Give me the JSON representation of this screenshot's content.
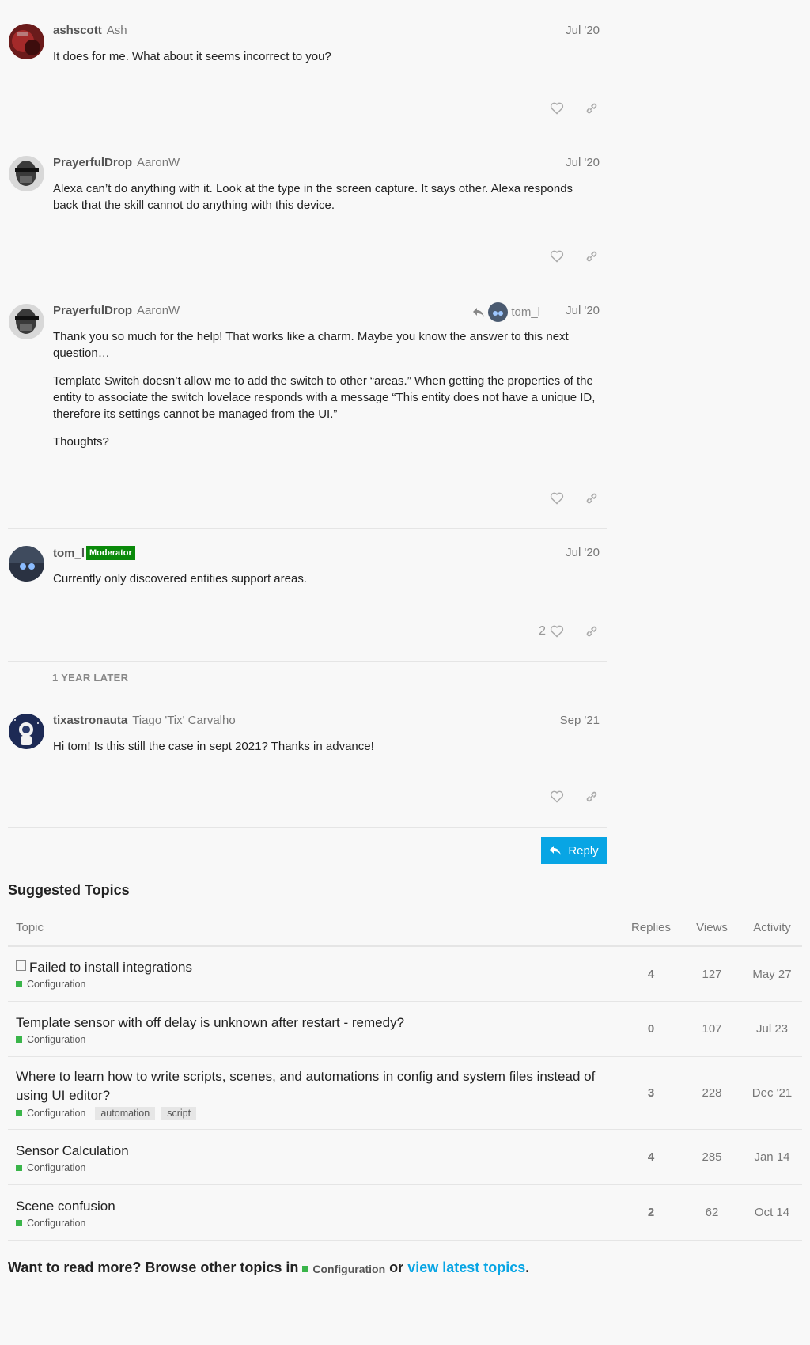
{
  "posts": [
    {
      "username": "ashscott",
      "fullname": "Ash",
      "date": "Jul '20",
      "paragraphs": [
        "It does for me. What about it seems incorrect to you?"
      ]
    },
    {
      "username": "PrayerfulDrop",
      "fullname": "AaronW",
      "date": "Jul '20",
      "paragraphs": [
        "Alexa can’t do anything with it. Look at the type in the screen capture. It says other. Alexa responds back that the skill cannot do anything with this device."
      ]
    },
    {
      "username": "PrayerfulDrop",
      "fullname": "AaronW",
      "date": "Jul '20",
      "reply_to": "tom_l",
      "paragraphs": [
        "Thank you so much for the help! That works like a charm. Maybe you know the answer to this next question…",
        "Template Switch doesn’t allow me to add the switch to other “areas.” When getting the properties of the entity to associate the switch lovelace responds with a message “This entity does not have a unique ID, therefore its settings cannot be managed from the UI.”",
        "Thoughts?"
      ]
    },
    {
      "username": "tom_l",
      "badge": "Moderator",
      "date": "Jul '20",
      "likes": "2",
      "paragraphs": [
        "Currently only discovered entities support areas."
      ]
    },
    {
      "username": "tixastronauta",
      "fullname": "Tiago 'Tix' Carvalho",
      "date": "Sep '21",
      "paragraphs": [
        "Hi tom! Is this still the case in sept 2021? Thanks in advance!"
      ]
    }
  ],
  "time_gap": "1 YEAR LATER",
  "reply_button": "Reply",
  "suggested": {
    "title": "Suggested Topics",
    "headers": {
      "topic": "Topic",
      "replies": "Replies",
      "views": "Views",
      "activity": "Activity"
    },
    "topics": [
      {
        "title": "Failed to install integrations",
        "category": "Configuration",
        "tags": [],
        "replies": "4",
        "views": "127",
        "activity": "May 27",
        "solved": true
      },
      {
        "title": "Template sensor with off delay is unknown after restart - remedy?",
        "category": "Configuration",
        "tags": [],
        "replies": "0",
        "views": "107",
        "activity": "Jul 23"
      },
      {
        "title": "Where to learn how to write scripts, scenes, and automations in config and system files instead of using UI editor?",
        "category": "Configuration",
        "tags": [
          "automation",
          "script"
        ],
        "replies": "3",
        "views": "228",
        "activity": "Dec '21"
      },
      {
        "title": "Sensor Calculation",
        "category": "Configuration",
        "tags": [],
        "replies": "4",
        "views": "285",
        "activity": "Jan 14"
      },
      {
        "title": "Scene confusion",
        "category": "Configuration",
        "tags": [],
        "replies": "2",
        "views": "62",
        "activity": "Oct 14"
      }
    ]
  },
  "footer": {
    "prefix": "Want to read more? Browse other topics in",
    "category": "Configuration",
    "middle": "or",
    "link": "view latest topics",
    "suffix": "."
  },
  "colors": {
    "accent": "#08a5e4",
    "category": "#3ab54a",
    "moderator": "#0a8a0a"
  }
}
